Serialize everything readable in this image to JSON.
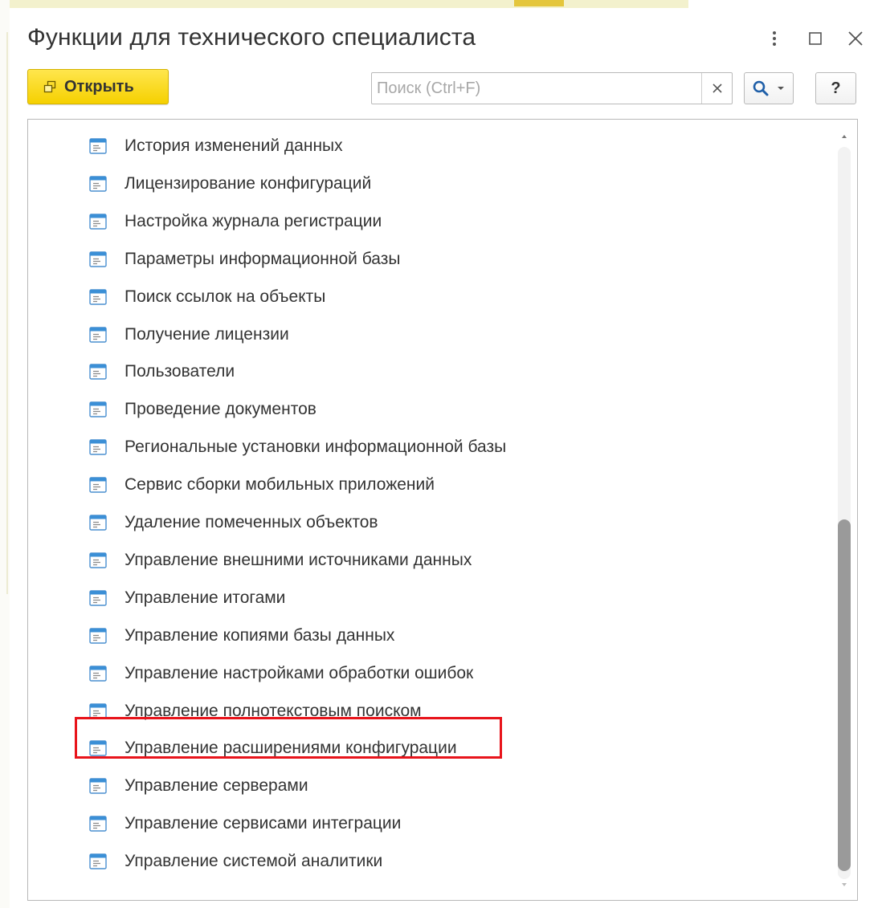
{
  "window": {
    "title": "Функции для технического специалиста"
  },
  "toolbar": {
    "open_label": "Открыть",
    "search_placeholder": "Поиск (Ctrl+F)",
    "search_value": "",
    "help_label": "?"
  },
  "icons": {
    "more": "more-vertical-icon",
    "maximize": "maximize-icon",
    "close": "close-icon",
    "open": "open-window-icon",
    "clear": "clear-icon",
    "search": "search-icon",
    "dropdown": "chevron-down-icon",
    "item": "form-icon"
  },
  "colors": {
    "primary_button": "#f5d000",
    "highlight": "#e8141b",
    "item_icon": "#3b8fd6"
  },
  "list": {
    "items": [
      {
        "label": "История изменений данных"
      },
      {
        "label": "Лицензирование конфигураций"
      },
      {
        "label": "Настройка журнала регистрации"
      },
      {
        "label": "Параметры информационной базы"
      },
      {
        "label": "Поиск ссылок на объекты"
      },
      {
        "label": "Получение лицензии"
      },
      {
        "label": "Пользователи"
      },
      {
        "label": "Проведение документов"
      },
      {
        "label": "Региональные установки информационной базы"
      },
      {
        "label": "Сервис сборки мобильных приложений"
      },
      {
        "label": "Удаление помеченных объектов"
      },
      {
        "label": "Управление внешними источниками данных"
      },
      {
        "label": "Управление итогами"
      },
      {
        "label": "Управление копиями базы данных"
      },
      {
        "label": "Управление настройками обработки ошибок"
      },
      {
        "label": "Управление полнотекстовым поиском"
      },
      {
        "label": "Управление расширениями конфигурации"
      },
      {
        "label": "Управление серверами"
      },
      {
        "label": "Управление сервисами интеграции"
      },
      {
        "label": "Управление системой аналитики"
      }
    ]
  }
}
